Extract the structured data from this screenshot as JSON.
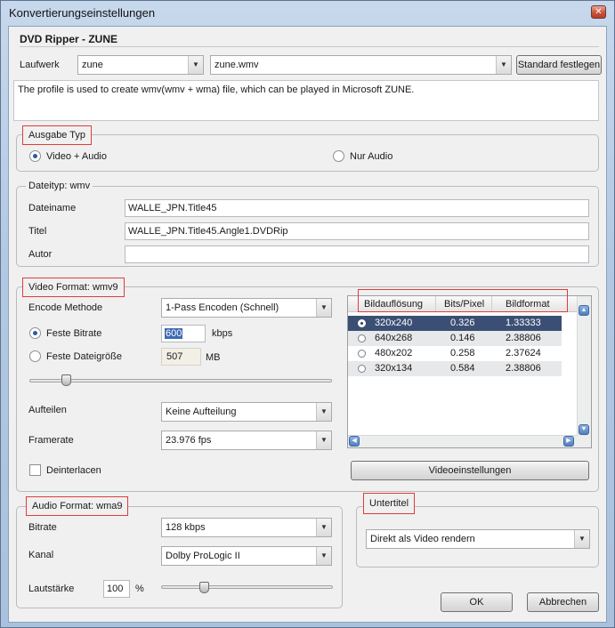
{
  "window": {
    "title": "Konvertierungseinstellungen",
    "close_glyph": "✕"
  },
  "header": {
    "title": "DVD Ripper - ZUNE"
  },
  "profile": {
    "laufwerk_label": "Laufwerk",
    "device_value": "zune",
    "profile_value": "zune.wmv",
    "set_default_button": "Standard festlegen",
    "description": "The profile is used to create wmv(wmv + wma) file, which can be played in Microsoft ZUNE."
  },
  "output_type": {
    "legend": "Ausgabe Typ",
    "options": [
      {
        "label": "Video + Audio",
        "selected": true
      },
      {
        "label": "Nur Audio",
        "selected": false
      }
    ]
  },
  "file_type": {
    "legend": "Dateityp: wmv",
    "fields": [
      {
        "label": "Dateiname",
        "value": "WALLE_JPN.Title45"
      },
      {
        "label": "Titel",
        "value": "WALLE_JPN.Title45.Angle1.DVDRip"
      },
      {
        "label": "Autor",
        "value": ""
      }
    ]
  },
  "video_format": {
    "legend": "Video Format: wmv9",
    "encode_label": "Encode Methode",
    "encode_value": "1-Pass Encoden (Schnell)",
    "fixed_bitrate_label": "Feste Bitrate",
    "fixed_bitrate_value": "600",
    "bitrate_unit": "kbps",
    "fixed_size_label": "Feste Dateigröße",
    "fixed_size_value": "507",
    "size_unit": "MB",
    "quality_slider_level": 0.12,
    "split_label": "Aufteilen",
    "split_value": "Keine Aufteilung",
    "framerate_label": "Framerate",
    "framerate_value": "23.976 fps",
    "deinterlace_label": "Deinterlacen",
    "video_settings_button": "Videoeinstellungen",
    "resolution_table": {
      "columns": [
        "Bildauflösung",
        "Bits/Pixel",
        "Bildformat"
      ],
      "rows": [
        [
          "320x240",
          "0.326",
          "1.33333"
        ],
        [
          "640x268",
          "0.146",
          "2.38806"
        ],
        [
          "480x202",
          "0.258",
          "2.37624"
        ],
        [
          "320x134",
          "0.584",
          "2.38806"
        ]
      ],
      "selected_index": 0
    }
  },
  "audio_format": {
    "legend": "Audio Format: wma9",
    "bitrate_label": "Bitrate",
    "bitrate_value": "128 kbps",
    "channel_label": "Kanal",
    "channel_value": "Dolby ProLogic II",
    "volume_label": "Lautstärke",
    "volume_value": "100",
    "volume_unit": "%",
    "volume_slider_level": 0.25
  },
  "subtitle": {
    "legend": "Untertitel",
    "value": "Direkt als Video rendern"
  },
  "buttons": {
    "ok": "OK",
    "cancel": "Abbrechen"
  },
  "colors": {
    "highlight_box": "#e03c3c",
    "selected_row": "#3b4f74"
  }
}
